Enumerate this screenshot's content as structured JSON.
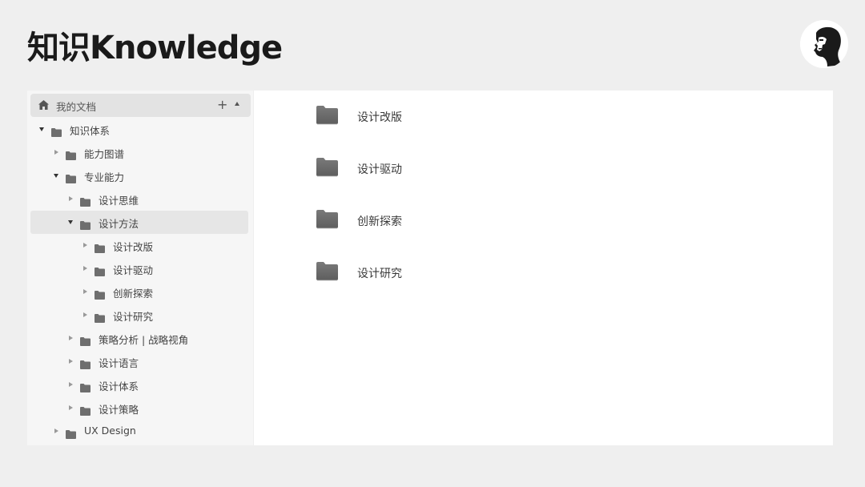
{
  "page": {
    "title": "知识Knowledge"
  },
  "sidebar": {
    "root": {
      "label": "我的文档",
      "icon": "home-icon",
      "add_icon": "plus-icon",
      "collapse_icon": "collapse-up-icon"
    },
    "items": [
      {
        "label": "知识体系",
        "depth": 0,
        "expanded": true,
        "selected": false
      },
      {
        "label": "能力图谱",
        "depth": 1,
        "expanded": false,
        "selected": false
      },
      {
        "label": "专业能力",
        "depth": 1,
        "expanded": true,
        "selected": false
      },
      {
        "label": "设计思维",
        "depth": 2,
        "expanded": false,
        "selected": false
      },
      {
        "label": "设计方法",
        "depth": 2,
        "expanded": true,
        "selected": true
      },
      {
        "label": "设计改版",
        "depth": 3,
        "expanded": false,
        "selected": false
      },
      {
        "label": "设计驱动",
        "depth": 3,
        "expanded": false,
        "selected": false
      },
      {
        "label": "创新探索",
        "depth": 3,
        "expanded": false,
        "selected": false
      },
      {
        "label": "设计研究",
        "depth": 3,
        "expanded": false,
        "selected": false
      },
      {
        "label": "策略分析 | 战略视角",
        "depth": 2,
        "expanded": false,
        "selected": false
      },
      {
        "label": "设计语言",
        "depth": 2,
        "expanded": false,
        "selected": false
      },
      {
        "label": "设计体系",
        "depth": 2,
        "expanded": false,
        "selected": false
      },
      {
        "label": "设计策略",
        "depth": 2,
        "expanded": false,
        "selected": false
      },
      {
        "label": "UX Design",
        "depth": 1,
        "expanded": false,
        "selected": false
      }
    ]
  },
  "content": {
    "folders": [
      {
        "label": "设计改版"
      },
      {
        "label": "设计驱动"
      },
      {
        "label": "创新探索"
      },
      {
        "label": "设计研究"
      }
    ]
  },
  "colors": {
    "background": "#efefef",
    "sidebar_bg": "#f6f6f6",
    "selected_row": "#e6e6e6",
    "folder": "#6e6e6e",
    "content_bg": "#ffffff"
  }
}
